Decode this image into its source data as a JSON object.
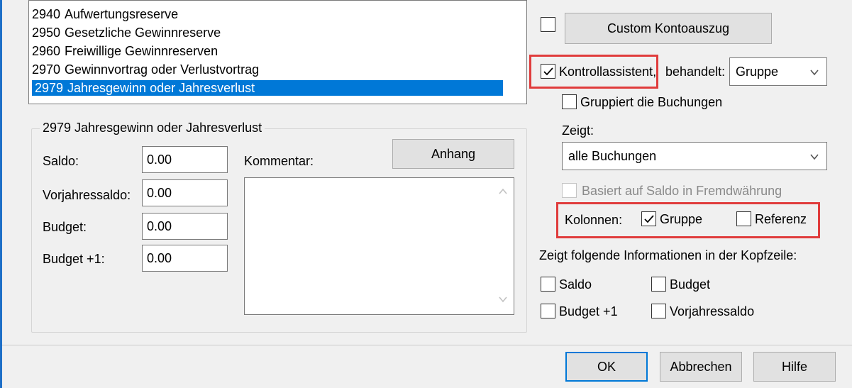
{
  "accounts_list": {
    "items": [
      {
        "code": "2940",
        "name": "Aufwertungsreserve"
      },
      {
        "code": "2950",
        "name": "Gesetzliche Gewinnreserve"
      },
      {
        "code": "2960",
        "name": "Freiwillige Gewinnreserven"
      },
      {
        "code": "2970",
        "name": "Gewinnvortrag oder Verlustvortrag"
      },
      {
        "code": "2979",
        "name": "Jahresgewinn oder Jahresverlust",
        "selected": true
      }
    ]
  },
  "account_group": {
    "title": "2979  Jahresgewinn oder Jahresverlust",
    "fields": [
      {
        "label": "Saldo:",
        "value": "0.00"
      },
      {
        "label": "Vorjahressaldo:",
        "value": "0.00"
      },
      {
        "label": "Budget:",
        "value": "0.00"
      },
      {
        "label": "Budget +1:",
        "value": "0.00"
      }
    ],
    "comment_label": "Kommentar:",
    "attachment_button": "Anhang"
  },
  "right_panel": {
    "custom_statement_button": "Custom Kontoauszug",
    "control_assistant_label": "Kontrollassistent,",
    "treated_label": "behandelt:",
    "treated_value": "Gruppe",
    "group_bookings_label": "Gruppiert die Buchungen",
    "shows_label": "Zeigt:",
    "shows_value": "alle Buchungen",
    "foreign_currency_label": "Basiert auf Saldo in Fremdwährung",
    "columns_label": "Kolonnen:",
    "column_group_label": "Gruppe",
    "column_reference_label": "Referenz",
    "header_info_label": "Zeigt folgende Informationen in der Kopfzeile:",
    "header_saldo": "Saldo",
    "header_budget": "Budget",
    "header_budget1": "Budget +1",
    "header_prev_saldo": "Vorjahressaldo"
  },
  "footer": {
    "ok": "OK",
    "cancel": "Abbrechen",
    "help": "Hilfe"
  },
  "colors": {
    "selection": "#0078d7",
    "highlight_box": "#e03c3c",
    "window_border": "#1e6fc7"
  }
}
